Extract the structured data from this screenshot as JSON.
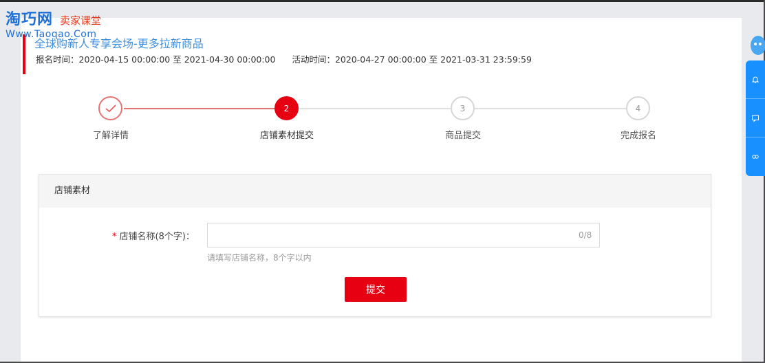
{
  "watermark": {
    "brand": "淘巧网",
    "class_text": "卖家课堂",
    "url": "Www.Taoqao.Com"
  },
  "activity": {
    "title": "全球购新人专享会场-更多拉新商品",
    "signup_time": "报名时间：2020-04-15 00:00:00 至 2021-04-30 00:00:00",
    "activity_time": "活动时间：2020-04-27 00:00:00 至 2021-03-31 23:59:59"
  },
  "steps": [
    {
      "number": "✓",
      "label": "了解详情",
      "state": "done"
    },
    {
      "number": "2",
      "label": "店铺素材提交",
      "state": "active"
    },
    {
      "number": "3",
      "label": "商品提交",
      "state": "todo"
    },
    {
      "number": "4",
      "label": "完成报名",
      "state": "todo"
    }
  ],
  "form": {
    "section_title": "店铺素材",
    "required_mark": "*",
    "field_label": "店铺名称(8个字)：",
    "field_value": "",
    "field_count": "0/8",
    "field_hint": "请填写店铺名称，8个字以内",
    "submit_label": "提交"
  },
  "side_widget": {
    "icons": [
      "bell-icon",
      "chat-icon",
      "link-icon"
    ]
  },
  "colors": {
    "accent": "#e60012",
    "title_blue": "#3d8fe0",
    "widget_blue": "#1890ff"
  }
}
